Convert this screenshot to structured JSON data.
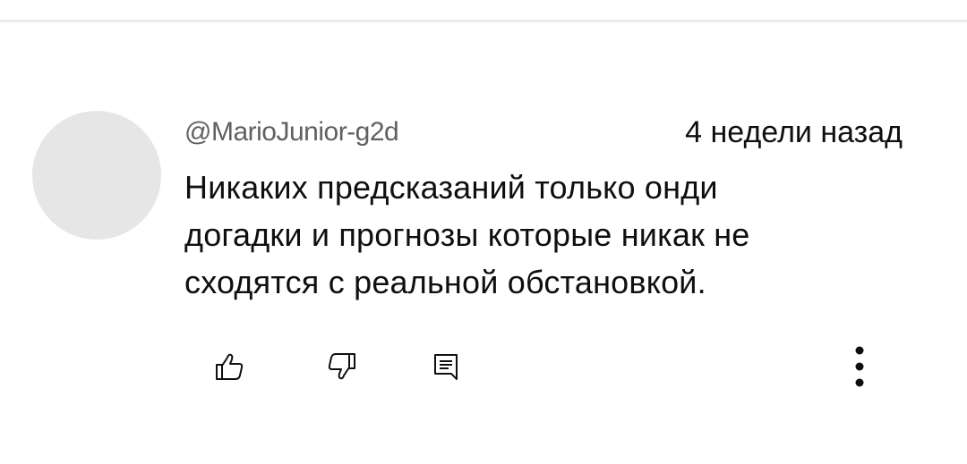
{
  "comment": {
    "author": "@MarioJunior-g2d",
    "timestamp": "4 недели назад",
    "lines": [
      "Никаких предсказаний только онди",
      "догадки и прогнозы которые никак не",
      "сходятся с реальной обстановкой."
    ]
  },
  "actions": {
    "like_icon": "thumb-up-icon",
    "dislike_icon": "thumb-down-icon",
    "reply_icon": "reply-comment-icon",
    "more_icon": "more-vertical-icon"
  },
  "colors": {
    "background": "#ffffff",
    "avatar": "#e6e6e6",
    "author_text": "#606060",
    "primary_text": "#0f0f0f"
  }
}
